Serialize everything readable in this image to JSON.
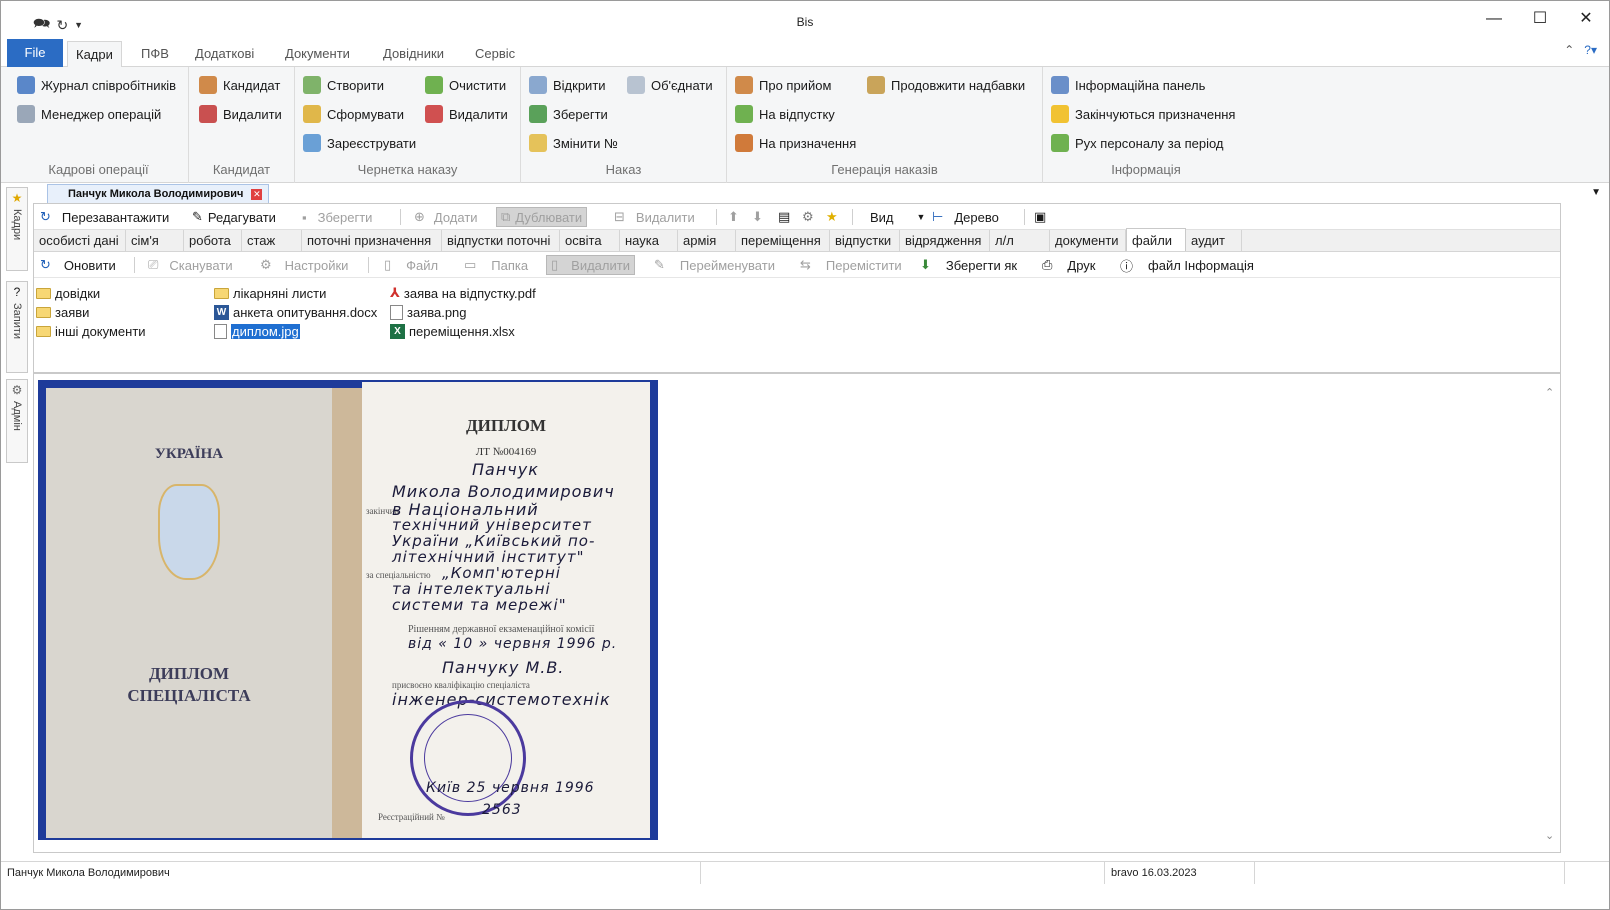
{
  "window": {
    "title": "Bis"
  },
  "menu_tabs": [
    "File",
    "Кадри",
    "ПФВ",
    "Додаткові",
    "Документи",
    "Довідники",
    "Сервіс"
  ],
  "ribbon": {
    "groups": [
      {
        "caption": "Кадрові операції",
        "buttons": [
          "Журнал співробітників",
          "Менеджер операцій"
        ]
      },
      {
        "caption": "Кандидат",
        "buttons": [
          "Кандидат",
          "Видалити"
        ]
      },
      {
        "caption": "Чернетка наказу",
        "buttons": [
          "Створити",
          "Сформувати",
          "Зареєструвати",
          "Очистити",
          "Видалити"
        ]
      },
      {
        "caption": "Наказ",
        "buttons": [
          "Відкрити",
          "Зберегти",
          "Змінити №",
          "Об'єднати"
        ]
      },
      {
        "caption": "Генерація наказів",
        "buttons": [
          "Про прийом",
          "На відпустку",
          "На призначення",
          "Продовжити надбавки"
        ]
      },
      {
        "caption": "Інформація",
        "buttons": [
          "Інформаційна панель",
          "Закінчуються призначення",
          "Рух персоналу за період"
        ]
      }
    ]
  },
  "doc_tab": {
    "label": "Панчук Микола Володимирович"
  },
  "side_rail": [
    "Кадри",
    "Запити",
    "Адмін"
  ],
  "toolbar1": {
    "reload": "Перезавантажити",
    "edit": "Редагувати",
    "save": "Зберегти",
    "add": "Додати",
    "duplicate": "Дублювати",
    "delete": "Видалити",
    "view": "Вид",
    "tree": "Дерево"
  },
  "subtabs": [
    "особисті дані",
    "сім'я",
    "робота",
    "стаж",
    "поточні призначення",
    "відпустки поточні",
    "освіта",
    "наука",
    "армія",
    "переміщення",
    "відпустки",
    "відрядження",
    "л/л",
    "документи",
    "файли",
    "аудит"
  ],
  "active_subtab": "файли",
  "toolbar2": {
    "refresh": "Оновити",
    "scan": "Сканувати",
    "settings": "Настройки",
    "file": "Файл",
    "folder": "Папка",
    "delete": "Видалити",
    "rename": "Перейменувати",
    "move": "Перемістити",
    "save_as": "Зберегти як",
    "print": "Друк",
    "file_info": "файл Інформація"
  },
  "files": {
    "col1": [
      "довідки",
      "заяви",
      "інші документи"
    ],
    "col2": [
      "лікарняні листи",
      "анкета опитування.docx",
      "диплом.jpg"
    ],
    "col3": [
      "заява на відпустку.pdf",
      "заява.png",
      "переміщення.xlsx"
    ],
    "selected": "диплом.jpg"
  },
  "diploma": {
    "country": "УКРАЇНА",
    "title_line1": "ДИПЛОМ",
    "title_line2": "СПЕЦІАЛІСТА",
    "heading": "ДИПЛОМ",
    "series": "ЛТ №004169",
    "surname": "Панчук",
    "name": "Микола Володимирович",
    "completed_label": "закінчив",
    "university_1": "в Національний",
    "university_2": "технічний університет",
    "university_3": "України „Київський по-",
    "university_4": "літехнічний інститут\"",
    "specialty_label": "за спеціальністю",
    "specialty_1": "„Комп'ютерні",
    "specialty_2": "та інтелектуальні",
    "specialty_3": "системи та мережі\"",
    "commission": "Рішенням державної екзаменаційної комісії",
    "date_line": "від « 10 » червня 1996 р.",
    "person_dat": "Панчуку М.В.",
    "qualification_label": "присвоєно кваліфікацію спеціаліста",
    "qualification": "інженер-системотехнік",
    "city_date": "Київ  25 червня 1996",
    "reg_label": "Реєстраційний №",
    "reg_no": "2563"
  },
  "status": {
    "user": "Панчук Микола Володимирович",
    "info": "bravo 16.03.2023"
  }
}
